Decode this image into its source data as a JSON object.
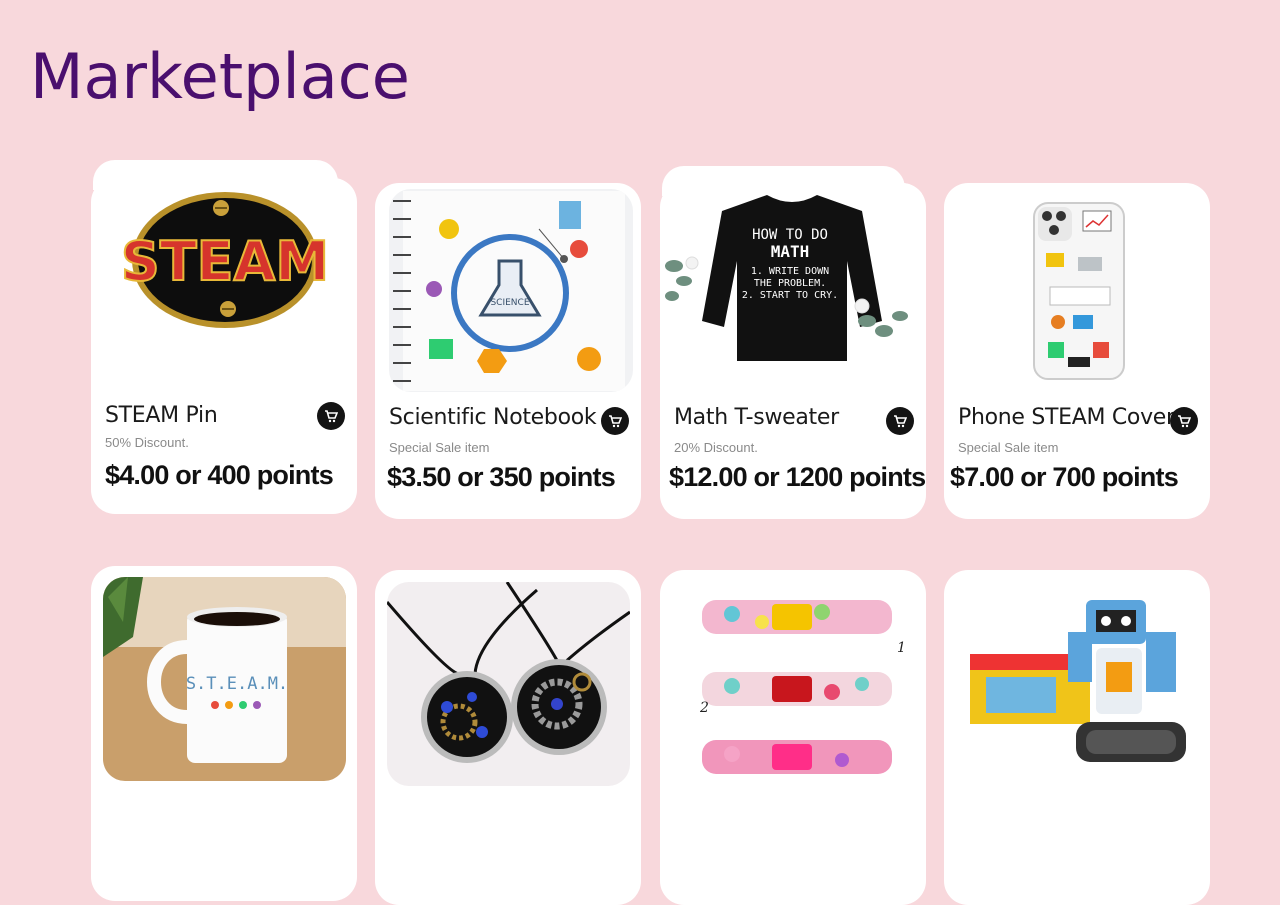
{
  "page": {
    "title": "Marketplace"
  },
  "products": [
    {
      "name": "STEAM Pin",
      "note": "50% Discount.",
      "price": "$4.00 or 400 points",
      "image": "steam-pin-image"
    },
    {
      "name": "Scientific Notebook",
      "note": "Special Sale item",
      "price": "$3.50 or 350 points",
      "image": "science-notebook-image"
    },
    {
      "name": "Math T-sweater",
      "note": "20% Discount.",
      "price": "$12.00 or 1200 points",
      "image": "math-sweater-image"
    },
    {
      "name": "Phone STEAM Cover",
      "note": "Special Sale item",
      "price": "$7.00 or 700 points",
      "image": "phone-cover-image"
    },
    {
      "image": "steam-mug-image"
    },
    {
      "image": "steampunk-necklace-image"
    },
    {
      "image": "pet-collar-image"
    },
    {
      "image": "lego-robot-image"
    }
  ],
  "image_text": {
    "pin": "STEAM",
    "notebook": "SCIENCE",
    "sweater_lines": [
      "HOW TO DO",
      "MATH",
      "1. WRITE DOWN",
      "THE PROBLEM.",
      "2. START TO CRY."
    ],
    "mug": "S.T.E.A.M."
  },
  "icons": {
    "cart": "shopping-cart-icon"
  },
  "colors": {
    "background": "#f8d8dc",
    "title": "#4a0f6e",
    "card": "#ffffff",
    "cart_button": "#141414"
  }
}
